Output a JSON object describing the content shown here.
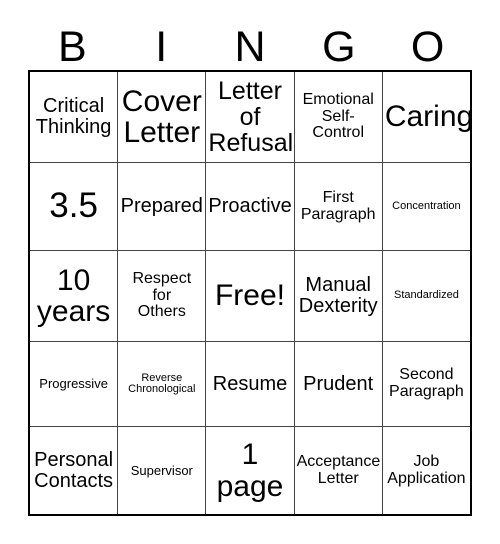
{
  "card": {
    "title": "BINGO Card",
    "header_letters": [
      "B",
      "I",
      "N",
      "G",
      "O"
    ],
    "free_space_label": "Free!",
    "colors": {
      "text": "#000000",
      "background": "#ffffff",
      "grid_line": "#444444",
      "grid_border": "#000000"
    },
    "rows": [
      [
        {
          "text": "Critical\nThinking",
          "size": "fs-m"
        },
        {
          "text": "Cover\nLetter",
          "size": "fs-xl"
        },
        {
          "text": "Letter\nof\nRefusal",
          "size": "fs-l"
        },
        {
          "text": "Emotional\nSelf-\nControl",
          "size": "fs-s"
        },
        {
          "text": "Caring",
          "size": "fs-xl"
        }
      ],
      [
        {
          "text": "3.5",
          "size": "fs-xxl"
        },
        {
          "text": "Prepared",
          "size": "fs-m"
        },
        {
          "text": "Proactive",
          "size": "fs-m"
        },
        {
          "text": "First\nParagraph",
          "size": "fs-s"
        },
        {
          "text": "Concentration",
          "size": "fs-xxs"
        }
      ],
      [
        {
          "text": "10\nyears",
          "size": "fs-xl"
        },
        {
          "text": "Respect\nfor\nOthers",
          "size": "fs-s"
        },
        {
          "text": "Free!",
          "size": "fs-xl"
        },
        {
          "text": "Manual\nDexterity",
          "size": "fs-m"
        },
        {
          "text": "Standardized",
          "size": "fs-xxs"
        }
      ],
      [
        {
          "text": "Progressive",
          "size": "fs-xs"
        },
        {
          "text": "Reverse\nChronological",
          "size": "fs-xxs"
        },
        {
          "text": "Resume",
          "size": "fs-m"
        },
        {
          "text": "Prudent",
          "size": "fs-m"
        },
        {
          "text": "Second\nParagraph",
          "size": "fs-s"
        }
      ],
      [
        {
          "text": "Personal\nContacts",
          "size": "fs-m"
        },
        {
          "text": "Supervisor",
          "size": "fs-xs"
        },
        {
          "text": "1\npage",
          "size": "fs-xl"
        },
        {
          "text": "Acceptance\nLetter",
          "size": "fs-s"
        },
        {
          "text": "Job\nApplication",
          "size": "fs-s"
        }
      ]
    ]
  }
}
